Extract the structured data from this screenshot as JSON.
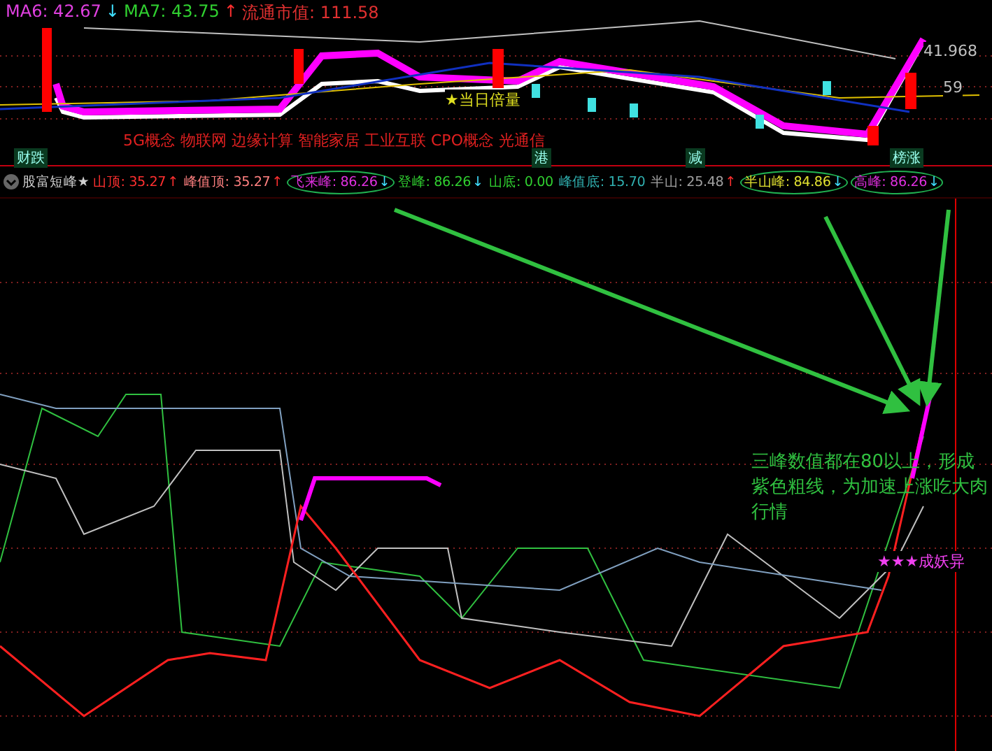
{
  "price_panel": {
    "ma_readings": [
      {
        "label": "MA6: 42.67",
        "arrow": "↓",
        "rising": false,
        "color": "#e040e0"
      },
      {
        "label": "MA7: 43.75",
        "arrow": "↑",
        "rising": true,
        "color": "#30d030"
      }
    ],
    "market_cap": "流通市值: 111.58",
    "concepts": "5G概念 物联网 边缘计算 智能家居 工业互联 CPO概念 光通信",
    "signal_tag": "★当日倍量",
    "price_labels": [
      "41.968",
      "59"
    ],
    "markers": [
      "财跌",
      "港",
      "减",
      "榜涨"
    ]
  },
  "indicator": {
    "title": "股富短峰★",
    "readings": [
      {
        "text": "山顶: 35.27",
        "arrow": "↑",
        "rising": true,
        "color": "#ff3030",
        "circled": false
      },
      {
        "text": "峰值顶: 35.27",
        "arrow": "↑",
        "rising": true,
        "color": "#ff8080",
        "circled": false
      },
      {
        "text": "飞来峰: 86.26",
        "arrow": "↓",
        "rising": false,
        "color": "#e030e0",
        "circled": true
      },
      {
        "text": "登峰: 86.26",
        "arrow": "↓",
        "rising": false,
        "color": "#30d030",
        "circled": false
      },
      {
        "text": "山底: 0.00",
        "color": "#30d030",
        "circled": false
      },
      {
        "text": "峰值底: 15.70",
        "color": "#30b0b0",
        "circled": false
      },
      {
        "text": "半山: 25.48",
        "arrow": "↑",
        "rising": true,
        "color": "#a0a0a0",
        "circled": false
      },
      {
        "text": "半山峰: 84.86",
        "arrow": "↓",
        "rising": false,
        "color": "#e0e030",
        "circled": true
      },
      {
        "text": "高峰: 86.26",
        "arrow": "↓",
        "rising": false,
        "color": "#e030e0",
        "circled": true
      }
    ],
    "annotation": "三峰数值都在80以上，形成紫色粗线，为加速上涨吃大肉行情",
    "signal_tag": "★★★成妖异"
  }
}
